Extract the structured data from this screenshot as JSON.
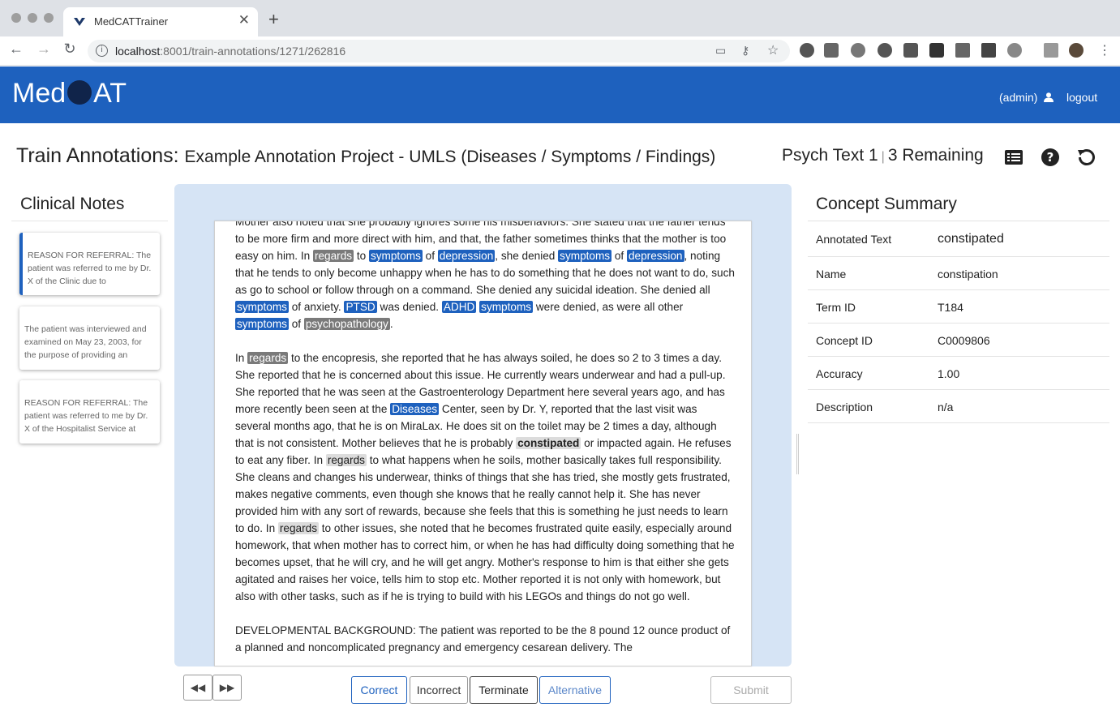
{
  "browser": {
    "tab_title": "MedCATTrainer",
    "url_host": "localhost",
    "url_rest": ":8001/train-annotations/1271/262816"
  },
  "header": {
    "logo_left": "Med",
    "logo_right": "AT",
    "user": "(admin)",
    "logout": "logout"
  },
  "title": {
    "prefix": "Train Annotations:",
    "project": "Example Annotation Project - UMLS (Diseases / Symptoms / Findings)",
    "doc_name": "Psych Text 1",
    "remaining": "3 Remaining"
  },
  "sidebar": {
    "title": "Clinical Notes",
    "notes": [
      {
        "text": "REASON FOR REFERRAL: The patient was referred to me by Dr. X of the Clinic due to"
      },
      {
        "text": "The patient was interviewed and examined on May 23, 2003, for the purpose of providing an"
      },
      {
        "text": "REASON FOR REFERRAL: The patient was referred to me by Dr. X of the Hospitalist Service at"
      }
    ]
  },
  "document": {
    "p1": [
      {
        "t": "Mother also noted that she probably ignores some his misbehaviors. She stated that the father tends to be more firm and more direct with him, and that, the father sometimes thinks that the mother is too easy on him. In "
      },
      {
        "t": "regards",
        "h": "grey"
      },
      {
        "t": " to "
      },
      {
        "t": "symptoms",
        "h": "blue"
      },
      {
        "t": " of "
      },
      {
        "t": "depression",
        "h": "blue"
      },
      {
        "t": ", she denied "
      },
      {
        "t": "symptoms",
        "h": "blue"
      },
      {
        "t": " of "
      },
      {
        "t": "depression",
        "h": "blue"
      },
      {
        "t": ", noting that he tends to only become unhappy when he has to do something that he does not want to do, such as go to school or follow through on a command. She denied any suicidal ideation. She denied all "
      },
      {
        "t": "symptoms",
        "h": "blue"
      },
      {
        "t": " of anxiety. "
      },
      {
        "t": "PTSD",
        "h": "blue"
      },
      {
        "t": " was denied. "
      },
      {
        "t": "ADHD",
        "h": "blue"
      },
      {
        "t": " "
      },
      {
        "t": "symptoms",
        "h": "blue"
      },
      {
        "t": " were denied, as were all other "
      },
      {
        "t": "symptoms",
        "h": "blue"
      },
      {
        "t": " of "
      },
      {
        "t": "psychopathology",
        "h": "grey"
      },
      {
        "t": "."
      }
    ],
    "p2": [
      {
        "t": "In "
      },
      {
        "t": "regards",
        "h": "grey"
      },
      {
        "t": " to the encopresis, she reported that he has always soiled, he does so 2 to 3 times a day. She reported that he is concerned about this issue. He currently wears underwear and had a pull-up. She reported that he was seen at the Gastroenterology Department here several years ago, and has more recently been seen at the "
      },
      {
        "t": "Diseases",
        "h": "blue"
      },
      {
        "t": " Center, seen by Dr. Y, reported that the last visit was several months ago, that he is on MiraLax. He does sit on the toilet may be 2 times a day, although that is not consistent. Mother believes that he is probably "
      },
      {
        "t": "constipated",
        "h": "focus"
      },
      {
        "t": " or impacted again. He refuses to eat any fiber. In "
      },
      {
        "t": "regards",
        "h": "light"
      },
      {
        "t": " to what happens when he soils, mother basically takes full responsibility. She cleans and changes his underwear, thinks of things that she has tried, she mostly gets frustrated, makes negative comments, even though she knows that he really cannot help it. She has never provided him with any sort of rewards, because she feels that this is something he just needs to learn to do. In "
      },
      {
        "t": "regards",
        "h": "light"
      },
      {
        "t": " to other issues, she noted that he becomes frustrated quite easily, especially around homework, that when mother has to correct him, or when he has had difficulty doing something that he becomes upset, that he will cry, and he will get angry. Mother's response to him is that either she gets agitated and raises her voice, tells him to stop etc. Mother reported it is not only with homework, but also with other tasks, such as if he is trying to build with his LEGOs and things do not go well."
      }
    ],
    "p3": "DEVELOPMENTAL BACKGROUND: The patient was reported to be the 8 pound 12 ounce product of a planned and noncomplicated pregnancy and emergency cesarean delivery. The"
  },
  "buttons": {
    "prev": "◀◀",
    "next": "▶▶",
    "correct": "Correct",
    "incorrect": "Incorrect",
    "terminate": "Terminate",
    "alternative": "Alternative",
    "submit": "Submit"
  },
  "concept_summary": {
    "title": "Concept Summary",
    "rows": [
      {
        "label": "Annotated Text",
        "value": "constipated"
      },
      {
        "label": "Name",
        "value": "constipation"
      },
      {
        "label": "Term ID",
        "value": "T184"
      },
      {
        "label": "Concept ID",
        "value": "C0009806"
      },
      {
        "label": "Accuracy",
        "value": "1.00"
      },
      {
        "label": "Description",
        "value": "n/a"
      }
    ]
  },
  "colors": {
    "brand_blue": "#1e61be",
    "highlight_grey": "#7a7a7a",
    "doc_background": "#d6e4f5"
  },
  "icons": [
    "medcat-favicon",
    "info-icon",
    "key-icon",
    "star-icon",
    "cast-icon",
    "user-icon",
    "list-icon",
    "help-icon",
    "reset-icon"
  ]
}
